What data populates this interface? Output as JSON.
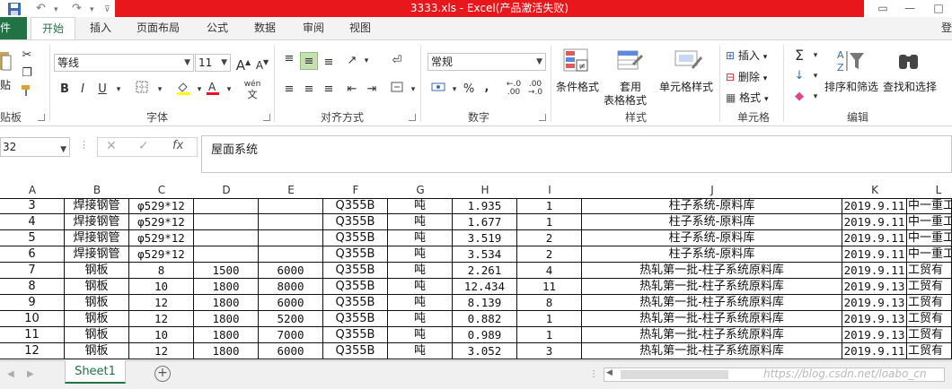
{
  "titlebar": {
    "title": "3333.xls -  Excel(产品激活失败)",
    "minimize": "—",
    "restore": "□"
  },
  "tabs": {
    "file": "件",
    "home": "开始",
    "insert": "插入",
    "layout": "页面布局",
    "formulas": "公式",
    "data": "数据",
    "review": "审阅",
    "view": "视图",
    "account": "登"
  },
  "ribbon": {
    "clipboard": {
      "paste": "贴",
      "label": "贴板"
    },
    "font": {
      "name": "等线",
      "size": "11",
      "grow": "A",
      "shrink": "A",
      "bold": "B",
      "italic": "I",
      "underline": "U",
      "wen": "wén",
      "label": "字体"
    },
    "align": {
      "label": "对齐方式"
    },
    "number": {
      "format": "常规",
      "percent": "%",
      "comma": ",",
      "label": "数字"
    },
    "styles": {
      "conditional": "条件格式",
      "table_top": "套用",
      "table_bottom": "表格格式",
      "cell_styles": "单元格样式",
      "label": "样式"
    },
    "cells": {
      "insert": "插入",
      "delete": "删除",
      "format": "格式",
      "label": "单元格"
    },
    "editing": {
      "sort": "排序和筛选",
      "find": "查找和选择",
      "label": "编辑"
    }
  },
  "formula_bar": {
    "name_box": "32",
    "fx": "fx",
    "content": "屋面系统"
  },
  "columns": [
    "A",
    "B",
    "C",
    "D",
    "E",
    "F",
    "G",
    "H",
    "I",
    "J",
    "K",
    "L"
  ],
  "rows": [
    [
      "3",
      "焊接钢管",
      "φ529*12",
      "",
      "",
      "Q355B",
      "吨",
      "1.935",
      "1",
      "柱子系统-原料库",
      "2019.9.11",
      "中一重工"
    ],
    [
      "4",
      "焊接钢管",
      "φ529*12",
      "",
      "",
      "Q355B",
      "吨",
      "1.677",
      "1",
      "柱子系统-原料库",
      "2019.9.11",
      "中一重工"
    ],
    [
      "5",
      "焊接钢管",
      "φ529*12",
      "",
      "",
      "Q355B",
      "吨",
      "3.519",
      "2",
      "柱子系统-原料库",
      "2019.9.11",
      "中一重工"
    ],
    [
      "6",
      "焊接钢管",
      "φ529*12",
      "",
      "",
      "Q355B",
      "吨",
      "3.534",
      "2",
      "柱子系统-原料库",
      "2019.9.11",
      "中一重工"
    ],
    [
      "7",
      "钢板",
      "8",
      "1500",
      "6000",
      "Q355B",
      "吨",
      "2.261",
      "4",
      "热轧第一批-柱子系统原料库",
      "2019.9.11",
      "工贸有"
    ],
    [
      "8",
      "钢板",
      "10",
      "1800",
      "8000",
      "Q355B",
      "吨",
      "12.434",
      "11",
      "热轧第一批-柱子系统原料库",
      "2019.9.13",
      "工贸有"
    ],
    [
      "9",
      "钢板",
      "12",
      "1800",
      "6000",
      "Q355B",
      "吨",
      "8.139",
      "8",
      "热轧第一批-柱子系统原料库",
      "2019.9.13",
      "工贸有"
    ],
    [
      "10",
      "钢板",
      "12",
      "1800",
      "5200",
      "Q355B",
      "吨",
      "0.882",
      "1",
      "热轧第一批-柱子系统原料库",
      "2019.9.13",
      "工贸有"
    ],
    [
      "11",
      "钢板",
      "10",
      "1800",
      "7000",
      "Q355B",
      "吨",
      "0.989",
      "1",
      "热轧第一批-柱子系统原料库",
      "2019.9.13",
      "工贸有"
    ],
    [
      "12",
      "钢板",
      "12",
      "1800",
      "6000",
      "Q355B",
      "吨",
      "3.052",
      "3",
      "热轧第一批-柱子系统原料库",
      "2019.9.11",
      "工贸有"
    ]
  ],
  "sheetbar": {
    "sheet_name": "Sheet1",
    "add": "+",
    "watermark": "https://blog.csdn.net/loabo_cn"
  },
  "colors": {
    "title_red": "#e8171b",
    "excel_green": "#217346"
  }
}
